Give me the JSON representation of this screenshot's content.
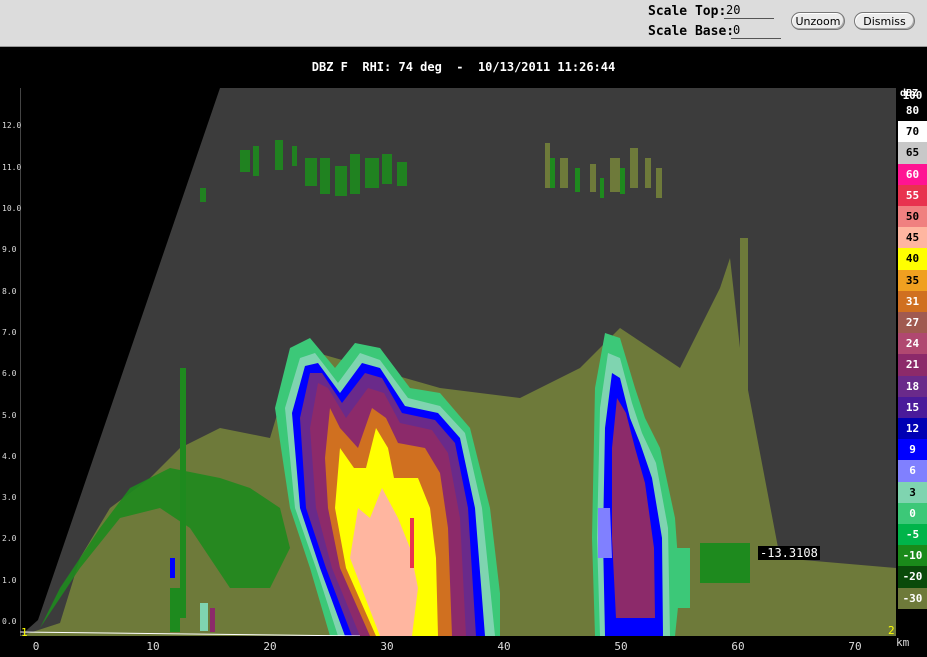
{
  "toolbar": {
    "scale_top_label": "Scale Top:",
    "scale_top_value": "20",
    "scale_base_label": "Scale Base:",
    "scale_base_value": "0",
    "unzoom_label": "Unzoom",
    "dismiss_label": "Dismiss"
  },
  "plot": {
    "title": "DBZ F  RHI: 74 deg  -  10/13/2011 11:26:44",
    "y_ticks": [
      "0.0",
      "1.0",
      "2.0",
      "3.0",
      "4.0",
      "5.0",
      "6.0",
      "7.0",
      "8.0",
      "9.0",
      "10.0",
      "11.0",
      "12.0"
    ],
    "x_ticks": [
      "0",
      "10",
      "20",
      "30",
      "40",
      "50",
      "60",
      "70"
    ],
    "x_units": "km",
    "end_label_left": "1",
    "end_label_right": "2",
    "cursor_readout": "-13.3108",
    "colors": {
      "background": "#3c3c3c",
      "noise_green": "#1e8a1e",
      "olive": "#6e7a3a"
    }
  },
  "legend": {
    "title": "dBZ",
    "entries": [
      {
        "label": "100",
        "color": "#ffffff"
      },
      {
        "label": "80",
        "color": "#000000"
      },
      {
        "label": "70",
        "color": "#ffffff"
      },
      {
        "label": "65",
        "color": "#c8c8c8"
      },
      {
        "label": "60",
        "color": "#ff1493"
      },
      {
        "label": "55",
        "color": "#e8334f"
      },
      {
        "label": "50",
        "color": "#f08080"
      },
      {
        "label": "45",
        "color": "#ffb6a0"
      },
      {
        "label": "40",
        "color": "#ffff00"
      },
      {
        "label": "35",
        "color": "#f0a020"
      },
      {
        "label": "31",
        "color": "#d07020"
      },
      {
        "label": "27",
        "color": "#a05a50"
      },
      {
        "label": "24",
        "color": "#b04870"
      },
      {
        "label": "21",
        "color": "#8c2a6a"
      },
      {
        "label": "18",
        "color": "#6a2a8a"
      },
      {
        "label": "15",
        "color": "#4a1a9a"
      },
      {
        "label": "12",
        "color": "#0000b4"
      },
      {
        "label": "9",
        "color": "#0000ff"
      },
      {
        "label": "6",
        "color": "#8080ff"
      },
      {
        "label": "3",
        "color": "#7fd4b0"
      },
      {
        "label": "0",
        "color": "#3cc878"
      },
      {
        "label": "-5",
        "color": "#00b44a"
      },
      {
        "label": "-10",
        "color": "#1a8a1a"
      },
      {
        "label": "-20",
        "color": "#0a4a0a"
      },
      {
        "label": "-30",
        "color": "#6e7a3a"
      }
    ]
  }
}
